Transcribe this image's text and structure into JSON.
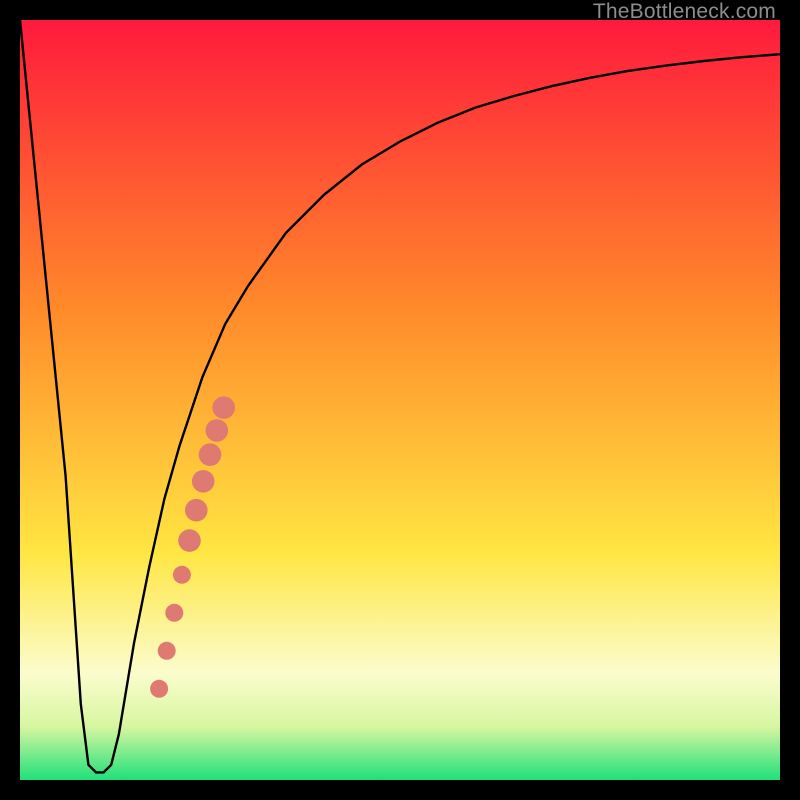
{
  "watermark": "TheBottleneck.com",
  "colors": {
    "frame": "#000000",
    "curve": "#000000",
    "marker": "#df7a72",
    "gradient_top": "#ff1a3c",
    "gradient_mid1": "#ff8a2a",
    "gradient_mid2": "#ffe642",
    "gradient_band_light": "#fbfccd",
    "gradient_bottom": "#1fe07a"
  },
  "chart_data": {
    "type": "line",
    "title": "",
    "xlabel": "",
    "ylabel": "",
    "xlim": [
      0,
      100
    ],
    "ylim": [
      0,
      100
    ],
    "series": [
      {
        "name": "bottleneck-curve",
        "x": [
          0,
          6,
          8,
          9,
          10,
          11,
          12,
          13,
          14,
          15,
          17,
          19,
          21,
          24,
          27,
          30,
          35,
          40,
          45,
          50,
          55,
          60,
          65,
          70,
          75,
          80,
          85,
          90,
          95,
          100
        ],
        "y": [
          100,
          40,
          10,
          2,
          1,
          1,
          2,
          6,
          12,
          18,
          28,
          37,
          44,
          53,
          60,
          65,
          72,
          77,
          81,
          84,
          86.5,
          88.5,
          90,
          91.3,
          92.4,
          93.3,
          94,
          94.6,
          95.1,
          95.5
        ]
      }
    ],
    "marker_series": {
      "name": "highlight-segment",
      "points": [
        {
          "x": 18.3,
          "y": 12,
          "r": 1.1
        },
        {
          "x": 19.3,
          "y": 17,
          "r": 1.1
        },
        {
          "x": 20.3,
          "y": 22,
          "r": 1.1
        },
        {
          "x": 21.3,
          "y": 27,
          "r": 1.1
        },
        {
          "x": 22.3,
          "y": 31.5,
          "r": 1.6
        },
        {
          "x": 23.2,
          "y": 35.5,
          "r": 1.6
        },
        {
          "x": 24.1,
          "y": 39.3,
          "r": 1.6
        },
        {
          "x": 25.0,
          "y": 42.8,
          "r": 1.6
        },
        {
          "x": 25.9,
          "y": 46.0,
          "r": 1.6
        },
        {
          "x": 26.8,
          "y": 49.0,
          "r": 1.6
        }
      ]
    },
    "gradient_stops": [
      {
        "offset": 0,
        "color": "#ff1a3c"
      },
      {
        "offset": 38,
        "color": "#ff8a2a"
      },
      {
        "offset": 70,
        "color": "#ffe642"
      },
      {
        "offset": 86,
        "color": "#fbfccd"
      },
      {
        "offset": 93,
        "color": "#d7f6a0"
      },
      {
        "offset": 100,
        "color": "#1fe07a"
      }
    ]
  }
}
